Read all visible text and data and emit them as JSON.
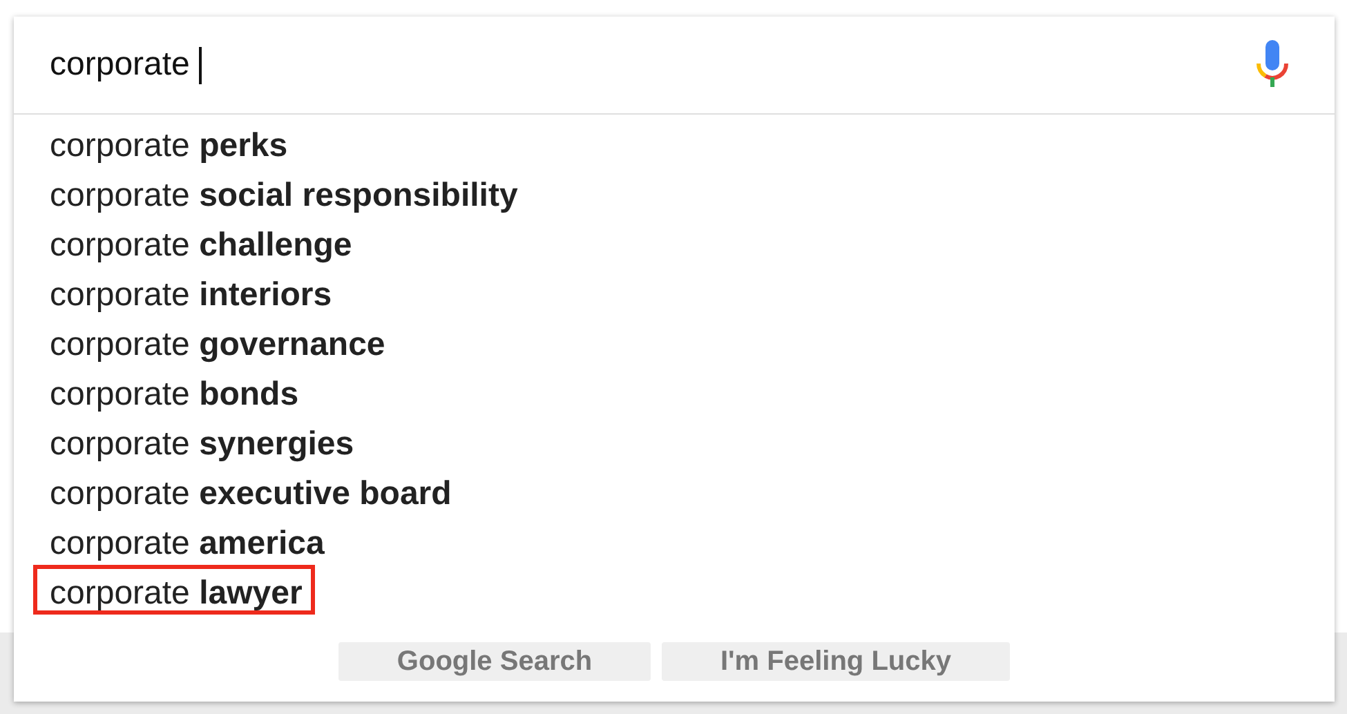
{
  "search": {
    "value": "corporate "
  },
  "suggestions": [
    {
      "text": "corporate **perks**",
      "highlighted": false
    },
    {
      "text": "corporate **social responsibility**",
      "highlighted": false
    },
    {
      "text": "corporate **challenge**",
      "highlighted": false
    },
    {
      "text": "corporate **interiors**",
      "highlighted": false
    },
    {
      "text": "corporate **governance**",
      "highlighted": false
    },
    {
      "text": "corporate **bonds**",
      "highlighted": false
    },
    {
      "text": "corporate **synergies**",
      "highlighted": false
    },
    {
      "text": "corporate **executive board**",
      "highlighted": false
    },
    {
      "text": "corporate **america**",
      "highlighted": false
    },
    {
      "text": "corporate **lawyer**",
      "highlighted": true
    }
  ],
  "buttons": [
    "Google Search",
    "I'm Feeling Lucky"
  ]
}
